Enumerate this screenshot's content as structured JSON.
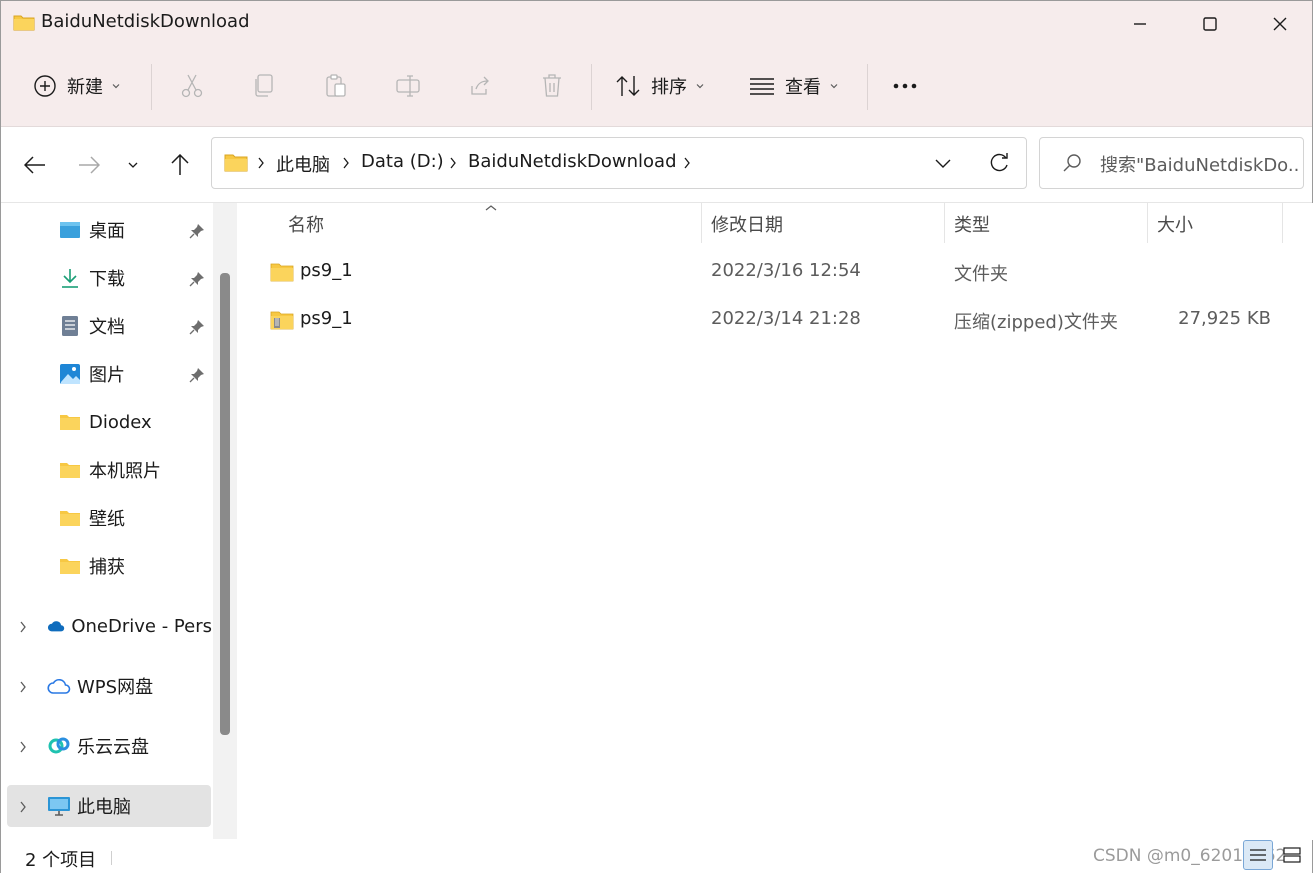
{
  "window": {
    "title": "BaiduNetdiskDownload"
  },
  "toolbar": {
    "new_label": "新建",
    "sort_label": "排序",
    "view_label": "查看",
    "more_label": "•••"
  },
  "address": {
    "crumbs": [
      "此电脑",
      "Data (D:)",
      "BaiduNetdiskDownload"
    ]
  },
  "search": {
    "placeholder": "搜索\"BaiduNetdiskDo..."
  },
  "sidebar": {
    "quick_access": [
      {
        "label": "桌面",
        "icon": "desktop-icon",
        "pinned": true
      },
      {
        "label": "下载",
        "icon": "download-icon",
        "pinned": true
      },
      {
        "label": "文档",
        "icon": "document-icon",
        "pinned": true
      },
      {
        "label": "图片",
        "icon": "picture-icon",
        "pinned": true
      },
      {
        "label": "Diodex",
        "icon": "folder-icon",
        "pinned": false
      },
      {
        "label": "本机照片",
        "icon": "folder-icon",
        "pinned": false
      },
      {
        "label": "壁纸",
        "icon": "folder-icon",
        "pinned": false
      },
      {
        "label": "捕获",
        "icon": "folder-icon",
        "pinned": false
      }
    ],
    "locations": [
      {
        "label": "OneDrive - Pers",
        "icon": "onedrive-icon"
      },
      {
        "label": "WPS网盘",
        "icon": "wps-cloud-icon"
      },
      {
        "label": "乐云云盘",
        "icon": "leyun-icon"
      },
      {
        "label": "此电脑",
        "icon": "this-pc-icon",
        "selected": true
      }
    ]
  },
  "columns": {
    "name": "名称",
    "modified": "修改日期",
    "type": "类型",
    "size": "大小"
  },
  "files": [
    {
      "name": "ps9_1",
      "modified": "2022/3/16 12:54",
      "type": "文件夹",
      "size": "",
      "icon": "folder-icon"
    },
    {
      "name": "ps9_1",
      "modified": "2022/3/14 21:28",
      "type": "压缩(zipped)文件夹",
      "size": "27,925 KB",
      "icon": "zip-folder-icon"
    }
  ],
  "status": {
    "count": "2 个项目"
  },
  "watermark": "CSDN @m0_62012462",
  "colors": {
    "titlebar_bg": "#f6ecec",
    "folder_yellow": "#f7c843",
    "selected_bg": "#e3e3e3",
    "accent_blue": "#0067c0"
  }
}
